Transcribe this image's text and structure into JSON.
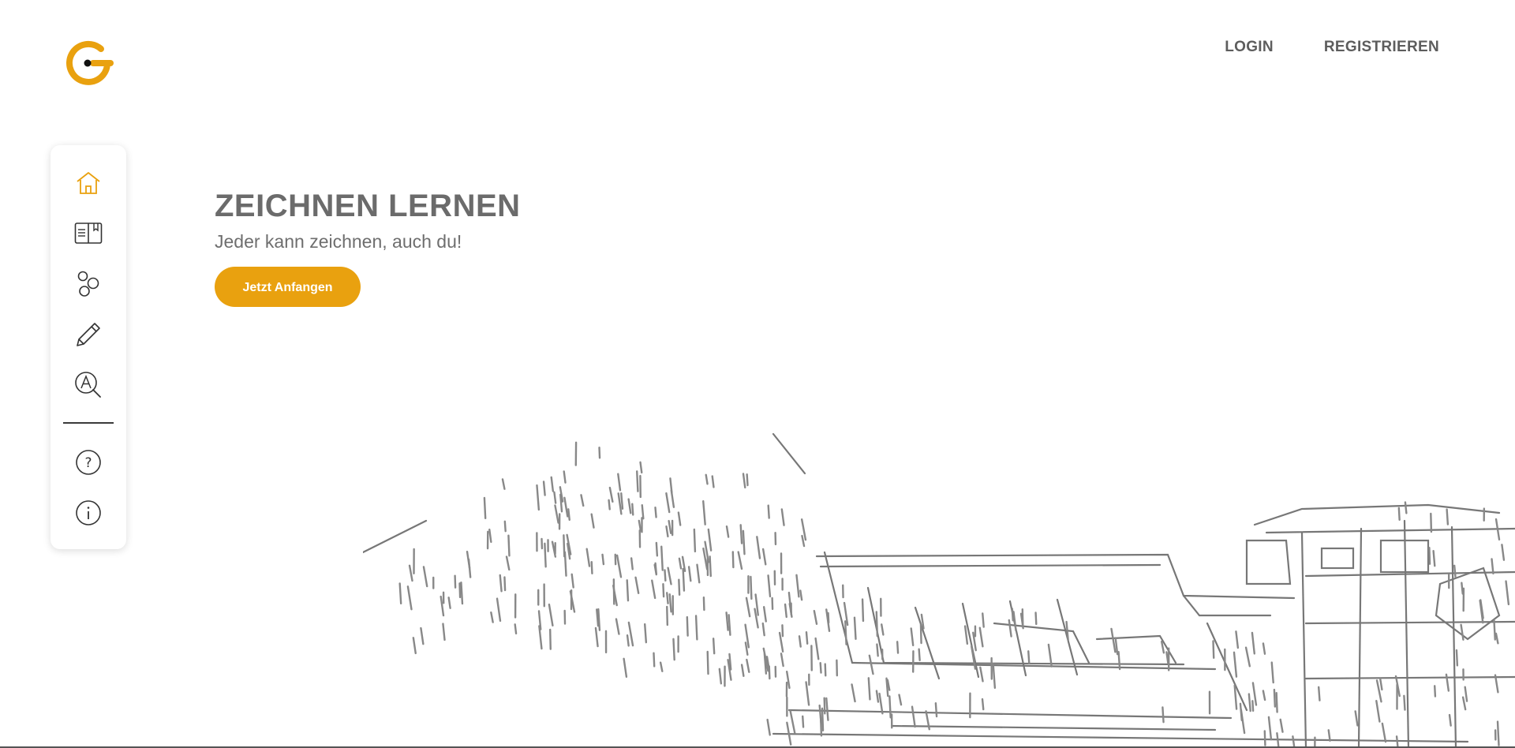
{
  "brand": {
    "logo_icon": "g-logo-icon",
    "accent_color": "#e9a10f"
  },
  "topnav": {
    "login_label": "LOGIN",
    "register_label": "REGISTRIEREN"
  },
  "sidebar": {
    "items": [
      {
        "name": "home",
        "icon": "home-icon",
        "active": true
      },
      {
        "name": "courses",
        "icon": "book-icon",
        "active": false
      },
      {
        "name": "community",
        "icon": "circles-icon",
        "active": false
      },
      {
        "name": "draw",
        "icon": "pencil-icon",
        "active": false
      },
      {
        "name": "search",
        "icon": "search-a-icon",
        "active": false
      }
    ],
    "bottom_items": [
      {
        "name": "help",
        "icon": "help-icon"
      },
      {
        "name": "info",
        "icon": "info-icon"
      }
    ]
  },
  "hero": {
    "title": "ZEICHNEN LERNEN",
    "subtitle": "Jeder kann zeichnen, auch du!",
    "cta_label": "Jetzt Anfangen"
  },
  "illustration": {
    "icon": "building-sketch-illustration"
  }
}
